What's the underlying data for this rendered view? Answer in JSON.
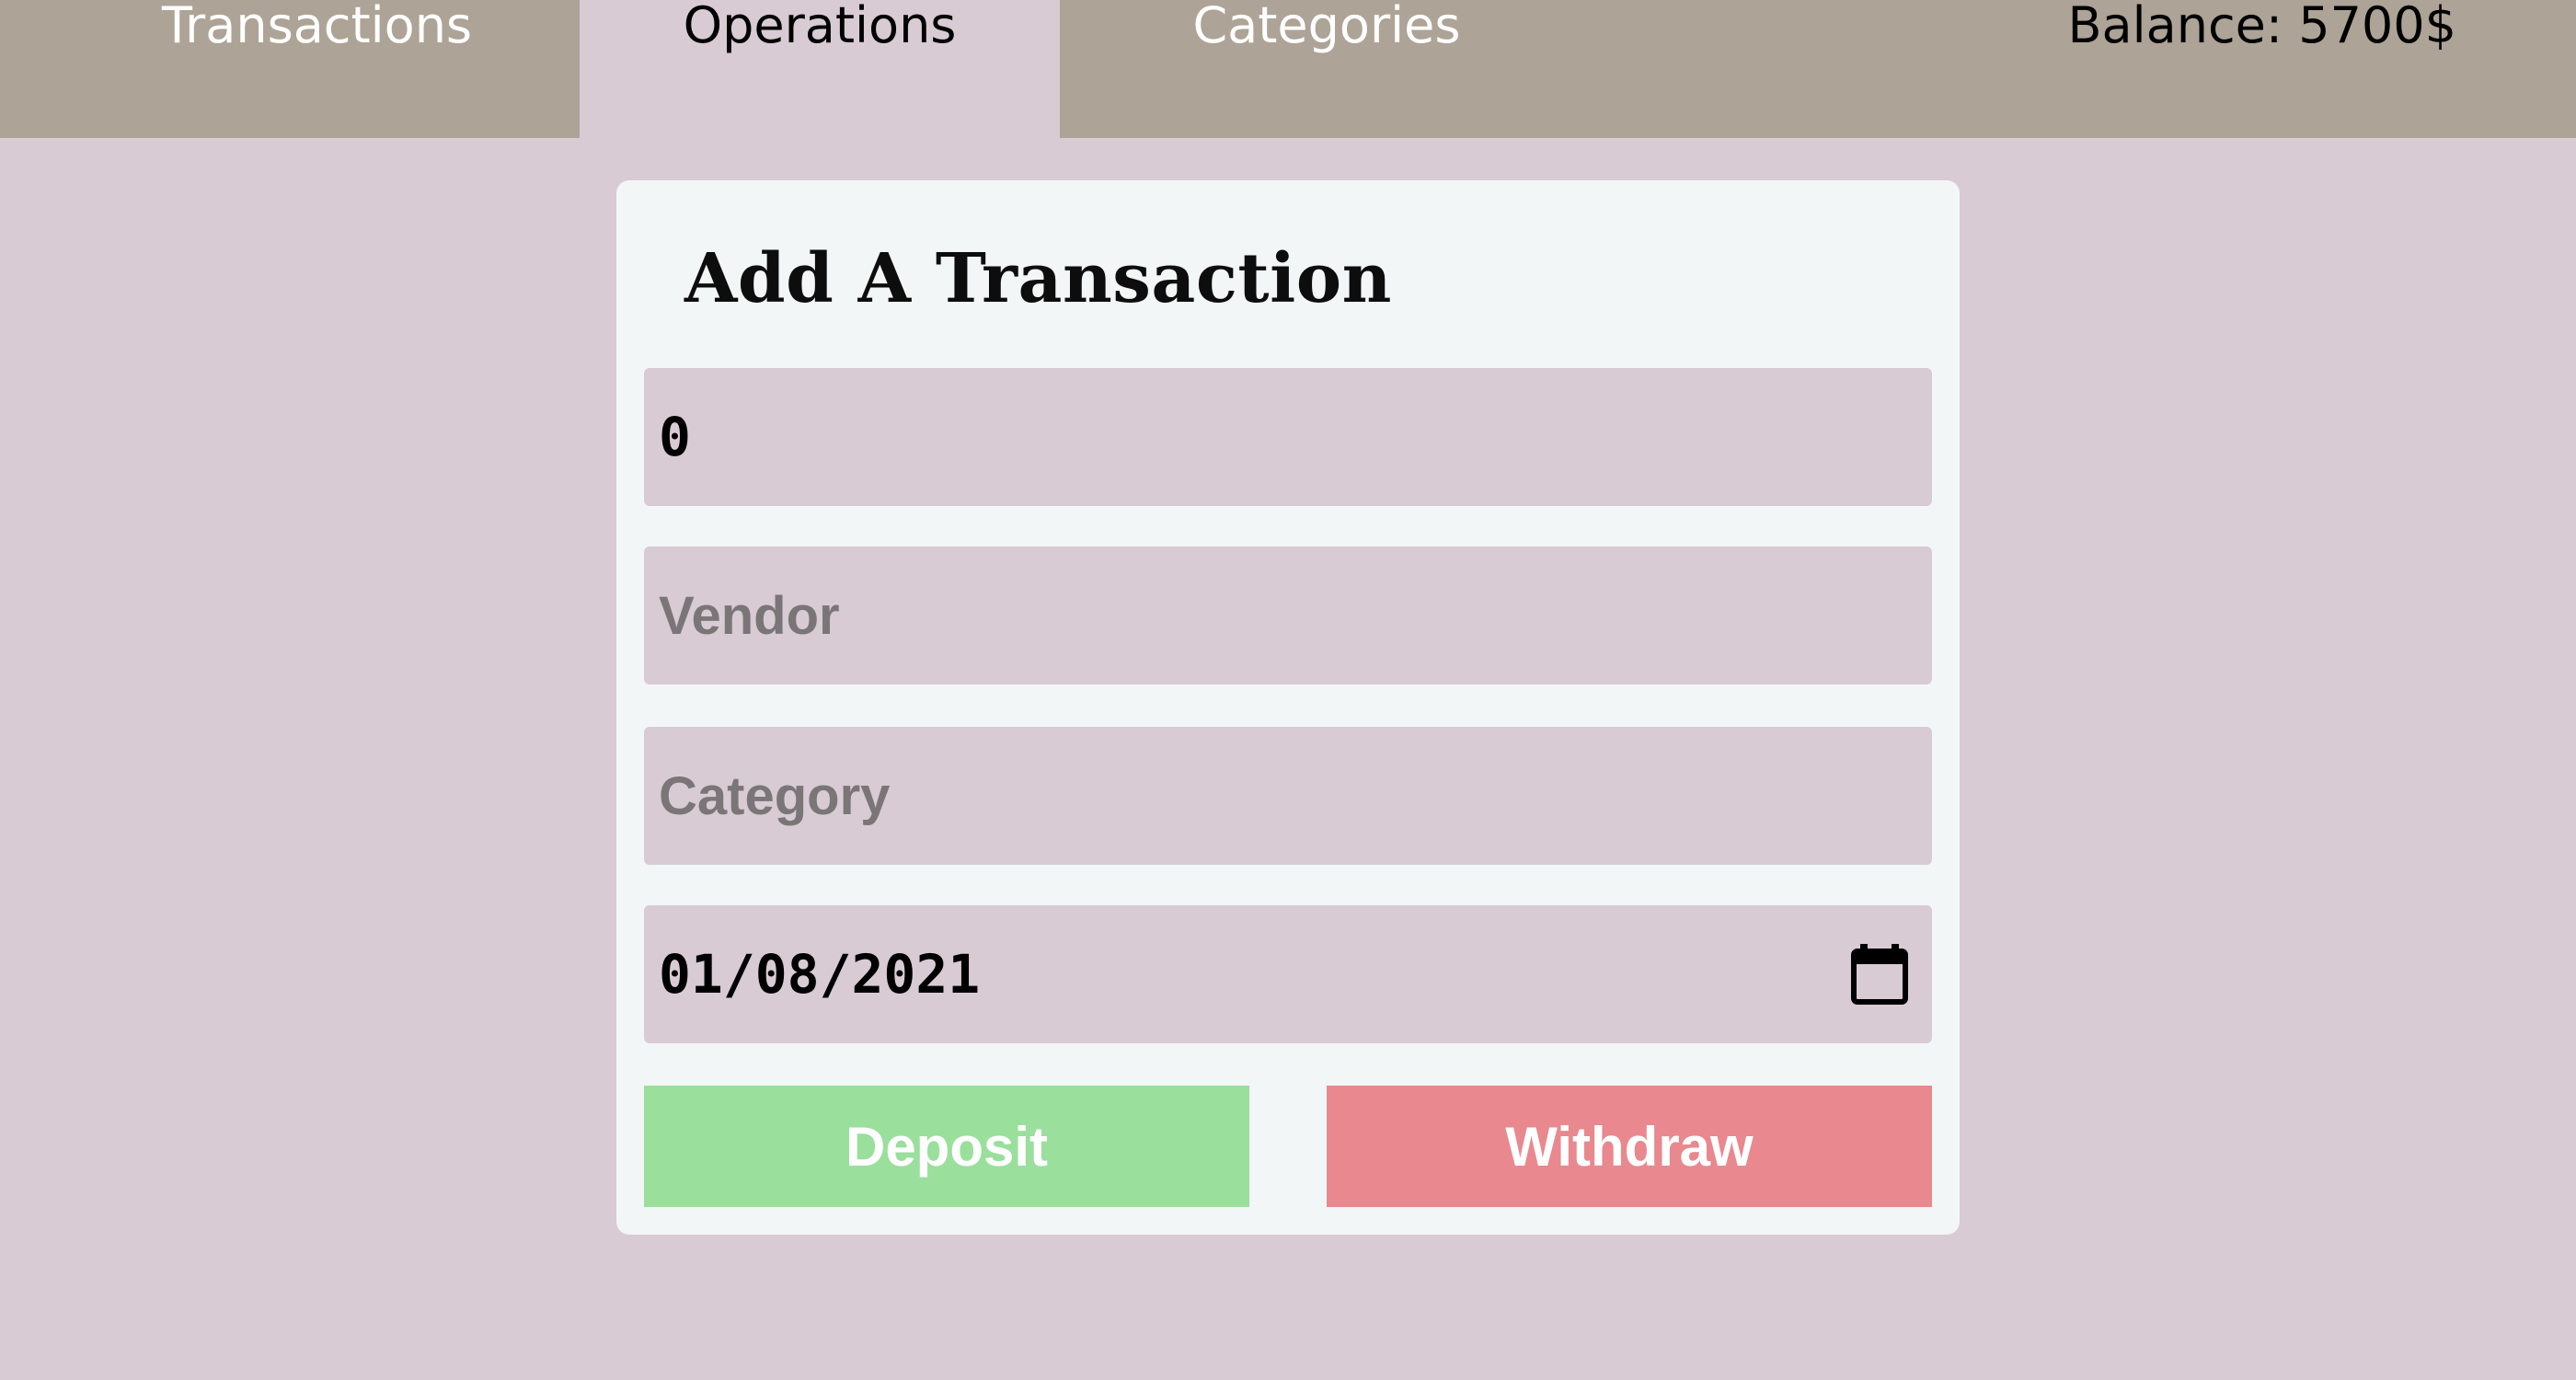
{
  "nav": {
    "tabs": [
      {
        "label": "Transactions",
        "active": false
      },
      {
        "label": "Operations",
        "active": true
      },
      {
        "label": "Categories",
        "active": false
      }
    ],
    "balance": "Balance: 5700$"
  },
  "form": {
    "title": "Add A Transaction",
    "amount": {
      "value": "0",
      "placeholder": ""
    },
    "vendor": {
      "value": "",
      "placeholder": "Vendor"
    },
    "category": {
      "value": "",
      "placeholder": "Category"
    },
    "date": {
      "value": "01/08/2021",
      "icon": "calendar-icon"
    },
    "deposit_label": "Deposit",
    "withdraw_label": "Withdraw"
  },
  "colors": {
    "page_background": "#d8cbd3",
    "navbar": "#ada396",
    "card": "#f3f6f7",
    "input_background": "#d8cbd3",
    "deposit": "#9adf9c",
    "withdraw": "#e9888e"
  }
}
